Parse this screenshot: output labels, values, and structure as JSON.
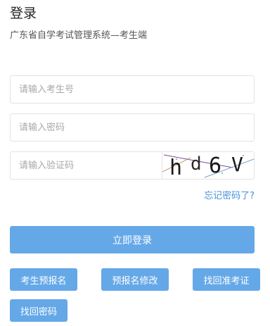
{
  "header": {
    "title": "登录",
    "subtitle": "广东省自学考试管理系统—考生端"
  },
  "form": {
    "exam_number_placeholder": "请输入考生号",
    "password_placeholder": "请输入密码",
    "captcha_placeholder": "请输入验证码",
    "captcha_text": "hd6V",
    "forgot_password": "忘记密码了?"
  },
  "actions": {
    "login": "立即登录",
    "buttons": [
      "考生预报名",
      "预报名修改",
      "找回准考证",
      "找回密码"
    ]
  },
  "colors": {
    "primary": "#65a8e8",
    "link": "#4a90d9"
  }
}
